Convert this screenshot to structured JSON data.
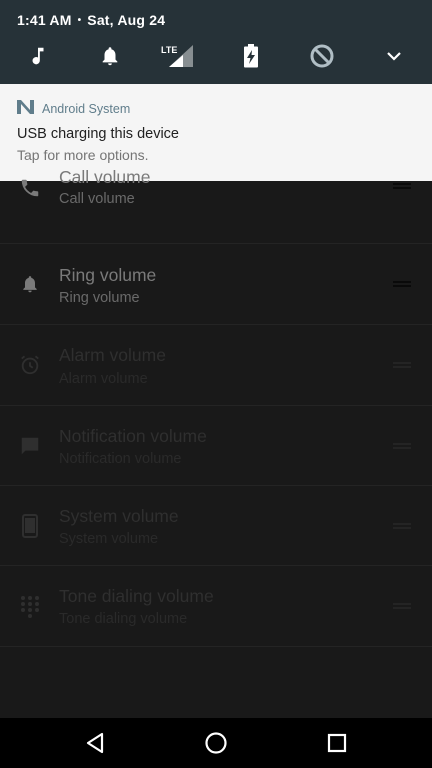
{
  "status_bar": {
    "time": "1:41 AM",
    "separator": "•",
    "date": "Sat, Aug 24"
  },
  "quick_settings": {
    "icons": [
      "music-note-icon",
      "bell-icon",
      "lte-signal-icon",
      "battery-charging-icon",
      "sync-disabled-icon",
      "chevron-down-icon"
    ],
    "network_label": "LTE"
  },
  "notification": {
    "app_name": "Android System",
    "title": "USB charging this device",
    "text": "Tap for more options."
  },
  "volume_list": [
    {
      "title": "Call volume",
      "subtitle": "Call volume",
      "icon": "phone-icon",
      "enabled": true
    },
    {
      "title": "Ring volume",
      "subtitle": "Ring volume",
      "icon": "bell-icon",
      "enabled": true
    },
    {
      "title": "Alarm volume",
      "subtitle": "Alarm volume",
      "icon": "alarm-icon",
      "enabled": false
    },
    {
      "title": "Notification volume",
      "subtitle": "Notification volume",
      "icon": "chat-icon",
      "enabled": false
    },
    {
      "title": "System volume",
      "subtitle": "System volume",
      "icon": "phone-device-icon",
      "enabled": false
    },
    {
      "title": "Tone dialing volume",
      "subtitle": "Tone dialing volume",
      "icon": "dialpad-icon",
      "enabled": false
    }
  ],
  "nav_bar": {
    "buttons": [
      "back-icon",
      "home-icon",
      "recents-icon"
    ]
  },
  "colors": {
    "shade_bg": "#263238",
    "card_bg": "#f5f5f5",
    "app_accent": "#607d8b",
    "list_bg": "#191919"
  }
}
